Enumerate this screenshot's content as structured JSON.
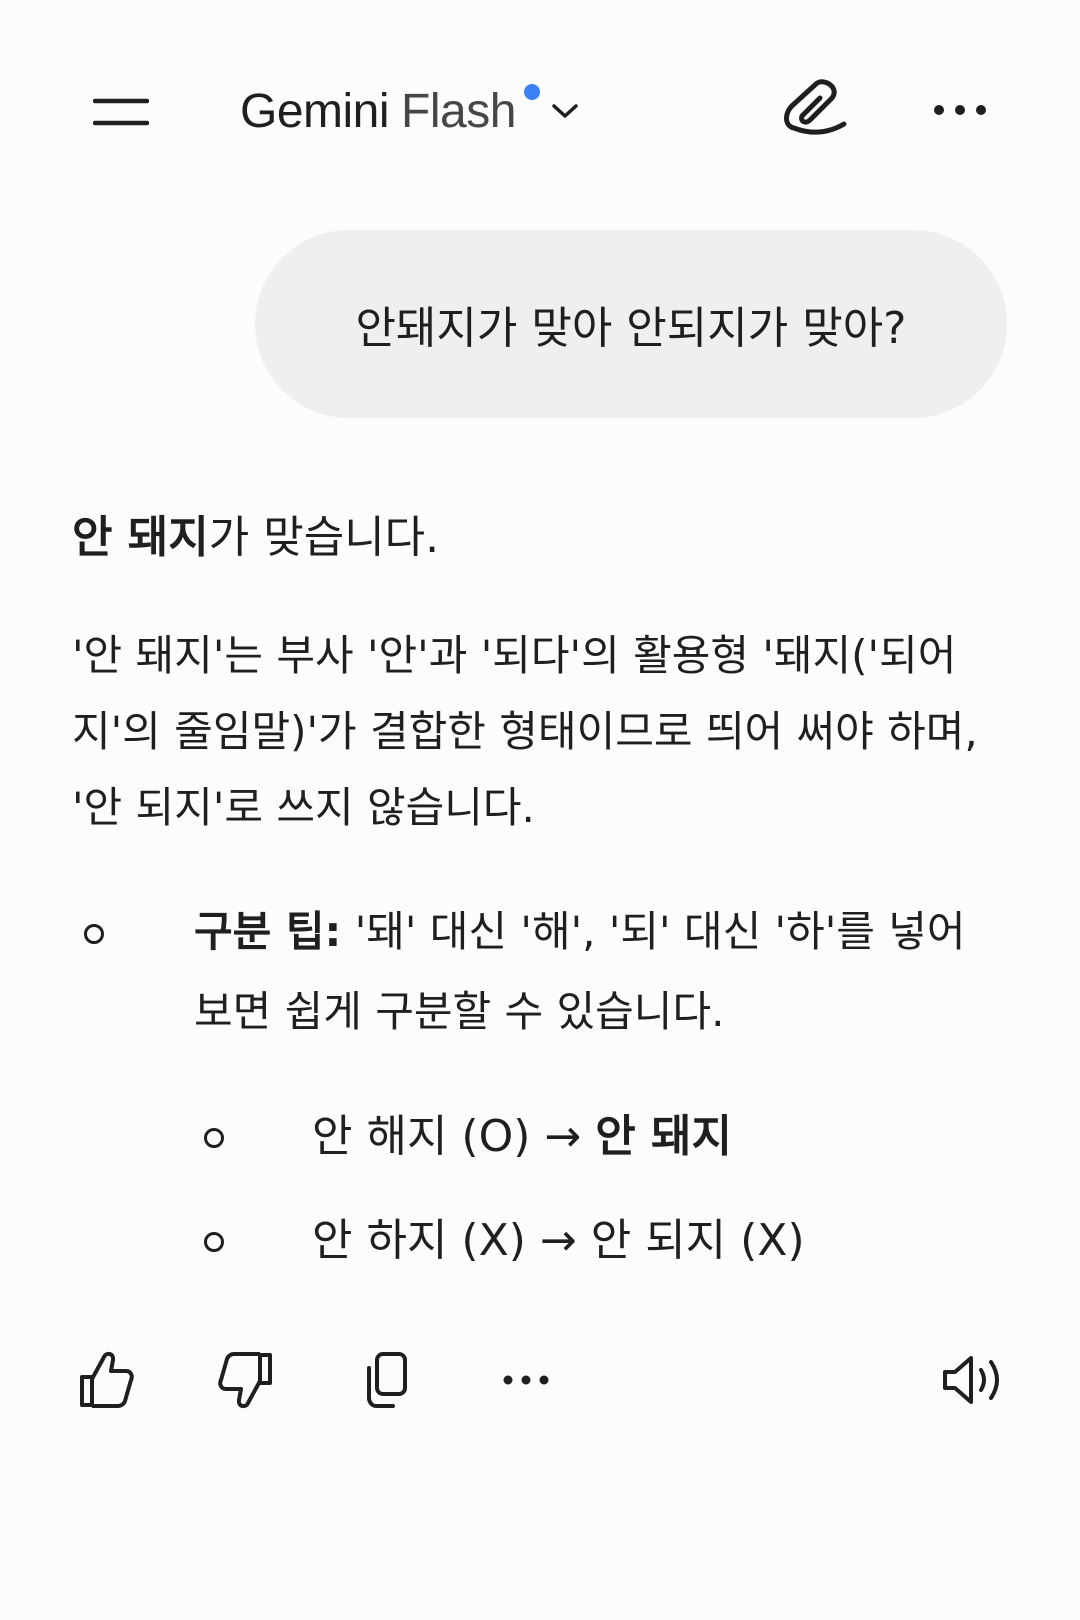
{
  "header": {
    "brand": "Gemini",
    "model": "Flash",
    "icons": {
      "menu": "menu-icon",
      "dropdown": "chevron-down-icon",
      "new_chat": "edit-icon",
      "more": "more-horizontal-icon"
    },
    "accent_color": "#3c82f6"
  },
  "user_message": "안돼지가 맞아 안되지가 맞아?",
  "response": {
    "lead_bold": "안 돼지",
    "lead_rest": "가 맞습니다.",
    "paragraph": "'안 돼지'는 부사 '안'과 '되다'의 활용형 '돼지('되어지'의 줄임말)'가 결합한 형태이므로 띄어 써야 하며, '안 되지'로 쓰지 않습니다.",
    "bullet": {
      "label": "구분 팁:",
      "text": " '돼' 대신 '해', '되' 대신 '하'를 넣어보면 쉽게 구분할 수 있습니다."
    },
    "sub_bullets": [
      {
        "plain": "안 해지 (O) → ",
        "bold": "안 돼지"
      },
      {
        "plain": "안 하지 (X) → 안 되지 (X)",
        "bold": ""
      }
    ]
  },
  "actions": {
    "icons": [
      "thumb-up-icon",
      "thumb-down-icon",
      "copy-icon",
      "more-horizontal-icon",
      "speaker-icon"
    ]
  }
}
